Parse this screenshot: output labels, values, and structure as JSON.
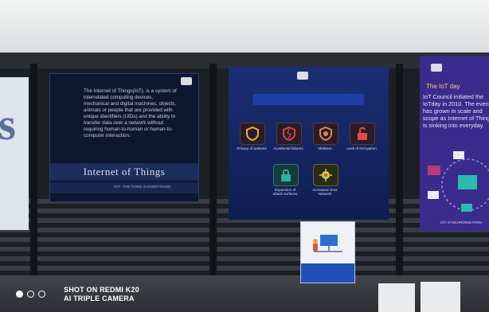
{
  "iot_poster": {
    "body": "The Internet of Things(IoT), is a system of interrelated computing devices, mechanical and digital machines, objects, animals or people that are provided with unique identifiers (UIDs) and the ability to transfer data over a network without requiring human-to-human or human-to-computer interaction.",
    "title": "Internet of Things",
    "tagline": "IOT - THE THING IS EVERYTHING"
  },
  "security_poster": {
    "items": [
      {
        "label": "Privacy of patients",
        "icon": "shield-icon"
      },
      {
        "label": "Accidental failures",
        "icon": "broken-shield-icon"
      },
      {
        "label": "Malware",
        "icon": "malware-shield-icon"
      },
      {
        "label": "Lack of encryption",
        "icon": "unlock-icon"
      },
      {
        "label": "Expansion of attack surfaces",
        "icon": "lock-icon"
      },
      {
        "label": "Increased virus Network",
        "icon": "virus-icon"
      }
    ]
  },
  "right_poster": {
    "heading": "The IoT day",
    "text": "IoT Council initiated the IoTday in 2010. The event has grown in scale and scope as Internet of Things is sinking into everyday.",
    "caption": "IOT SYNCHRONIZATION"
  },
  "watermark": {
    "line1": "SHOT ON REDMI K20",
    "line2": "AI TRIPLE CAMERA"
  }
}
